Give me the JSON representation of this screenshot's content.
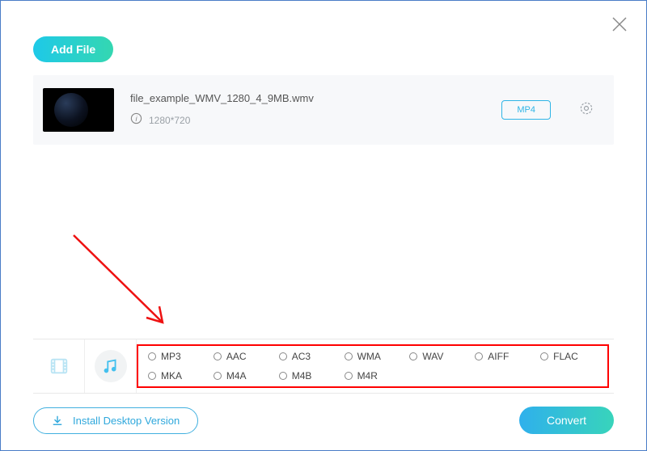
{
  "toolbar": {
    "add_file_label": "Add File"
  },
  "file": {
    "name": "file_example_WMV_1280_4_9MB.wmv",
    "resolution": "1280*720",
    "output_format": "MP4"
  },
  "formats": {
    "audio_row1": [
      "MP3",
      "AAC",
      "AC3",
      "WMA",
      "WAV",
      "AIFF",
      "FLAC"
    ],
    "audio_row2": [
      "MKA",
      "M4A",
      "M4B",
      "M4R"
    ]
  },
  "footer": {
    "install_label": "Install Desktop Version",
    "convert_label": "Convert"
  }
}
